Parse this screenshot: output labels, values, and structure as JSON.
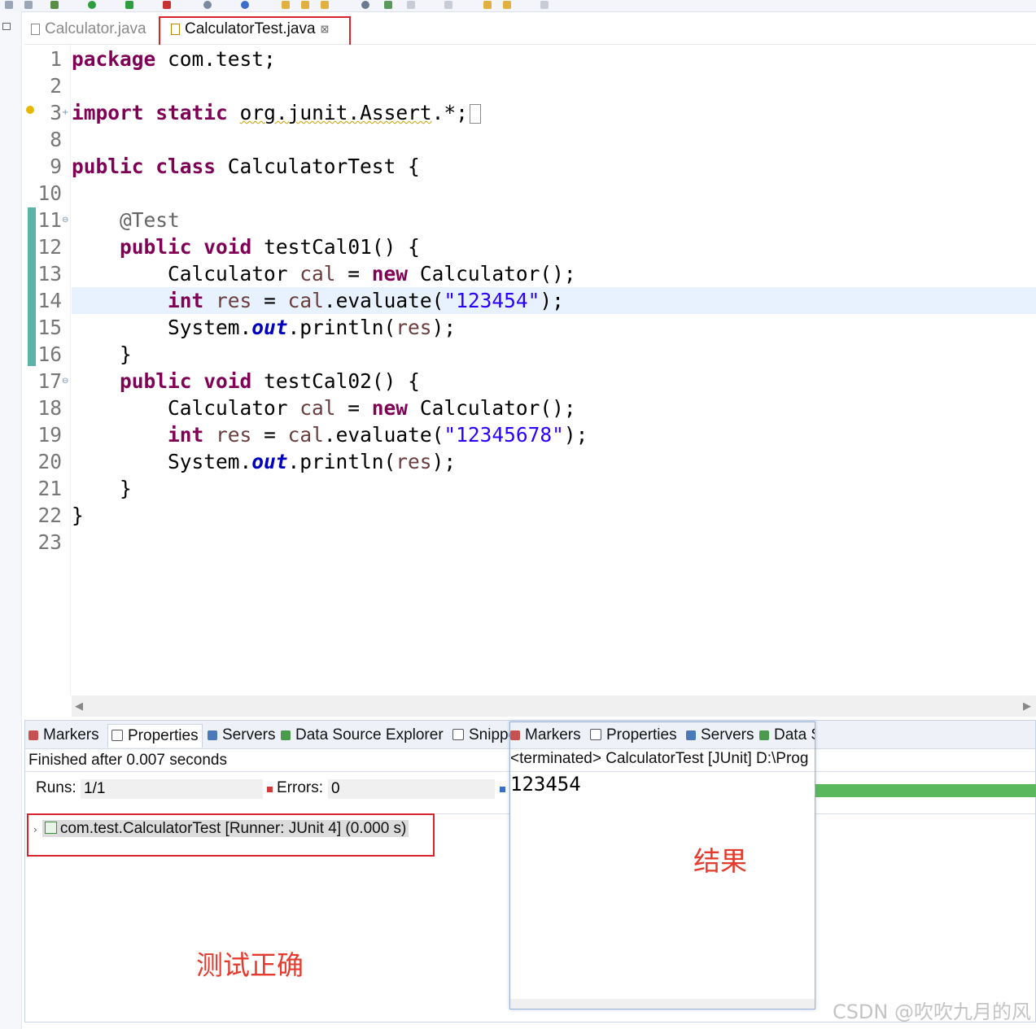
{
  "editor_tabs": [
    {
      "label": "Calculator.java",
      "active": false
    },
    {
      "label": "CalculatorTest.java",
      "active": true,
      "close": "⊠"
    }
  ],
  "code": {
    "lines": [
      {
        "n": "1",
        "html": "<span class=\"kw\">package</span> com.test;"
      },
      {
        "n": "2",
        "html": ""
      },
      {
        "n": "3",
        "html": "<span class=\"kw\">import</span> <span class=\"kw\">static</span> <span class=\"wavy\">org.junit.Assert</span>.*;<span class=\"cursor-box\"></span>"
      },
      {
        "n": "8",
        "html": ""
      },
      {
        "n": "9",
        "html": "<span class=\"kw\">public</span> <span class=\"kw\">class</span> CalculatorTest {"
      },
      {
        "n": "10",
        "html": ""
      },
      {
        "n": "11",
        "html": "    <span class=\"ann\">@Test</span>"
      },
      {
        "n": "12",
        "html": "    <span class=\"kw\">public</span> <span class=\"kw\">void</span> testCal01() {"
      },
      {
        "n": "13",
        "html": "        Calculator <span class=\"var\">cal</span> = <span class=\"kw\">new</span> Calculator();"
      },
      {
        "n": "14",
        "html": "        <span class=\"kw\">int</span> <span class=\"var\">res</span> = <span class=\"var\">cal</span>.evaluate(<span class=\"str\">\"123454\"</span>);"
      },
      {
        "n": "15",
        "html": "        System.<span class=\"fld\">out</span>.println(<span class=\"var\">res</span>);"
      },
      {
        "n": "16",
        "html": "    }"
      },
      {
        "n": "17",
        "html": "    <span class=\"kw\">public</span> <span class=\"kw\">void</span> testCal02() {"
      },
      {
        "n": "18",
        "html": "        Calculator <span class=\"var\">cal</span> = <span class=\"kw\">new</span> Calculator();"
      },
      {
        "n": "19",
        "html": "        <span class=\"kw\">int</span> <span class=\"var\">res</span> = <span class=\"var\">cal</span>.evaluate(<span class=\"str\">\"12345678\"</span>);"
      },
      {
        "n": "20",
        "html": "        System.<span class=\"fld\">out</span>.println(<span class=\"var\">res</span>);"
      },
      {
        "n": "21",
        "html": "    }"
      },
      {
        "n": "22",
        "html": "}"
      },
      {
        "n": "23",
        "html": ""
      }
    ],
    "highlighted_line": "14",
    "fold_markers": {
      "3": "+",
      "11": "⊖",
      "17": "⊖"
    }
  },
  "junit_panel": {
    "tabs": [
      "Markers",
      "Properties",
      "Servers",
      "Data Source Explorer",
      "Snippe"
    ],
    "status": "Finished after 0.007 seconds",
    "runs_label": "Runs:",
    "runs_value": "1/1",
    "errors_label": "Errors:",
    "errors_value": "0",
    "tree_item": "com.test.CalculatorTest [Runner: JUnit 4] (0.000 s)"
  },
  "console_panel": {
    "tabs": [
      "Markers",
      "Properties",
      "Servers",
      "Data S"
    ],
    "status": "<terminated> CalculatorTest [JUnit] D:\\Prog",
    "output": "123454"
  },
  "annotations": {
    "result_label": "结果",
    "test_correct_label": "测试正确"
  },
  "watermark": "CSDN @吹吹九月的风",
  "colors": {
    "keyword": "#7f0055",
    "string": "#2a00ff",
    "annotation_box": "#d9232d",
    "progress": "#5cb85c"
  }
}
